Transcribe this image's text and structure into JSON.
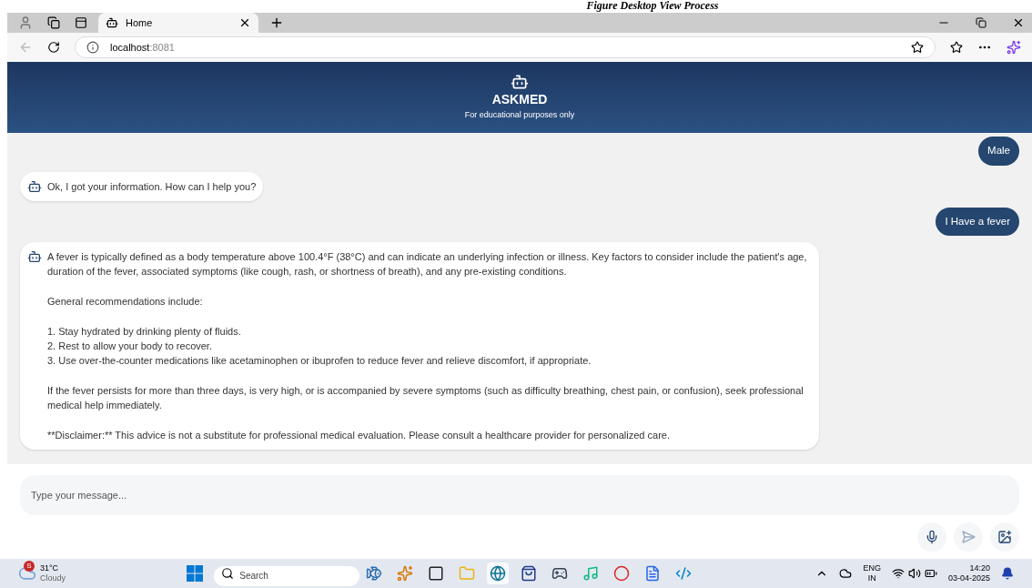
{
  "caption": "Figure Desktop View Process",
  "browser": {
    "tab_title": "Home",
    "url_host": "localhost",
    "url_port": ":8081"
  },
  "header": {
    "title": "ASKMED",
    "subtitle": "For educational purposes only"
  },
  "messages": [
    {
      "kind": "user",
      "blocks": [
        [
          "Male"
        ]
      ]
    },
    {
      "kind": "bot",
      "blocks": [
        [
          "Ok, I got your information. How can I help you?"
        ]
      ]
    },
    {
      "kind": "user",
      "blocks": [
        [
          "I Have a fever"
        ]
      ]
    },
    {
      "kind": "bot",
      "blocks": [
        [
          "A fever is typically defined as a body temperature above 100.4°F (38°C) and can indicate an underlying infection or illness. Key factors to consider include the patient's age, duration of the fever, associated symptoms (like cough, rash, or shortness of breath), and any pre-existing conditions."
        ],
        [
          "General recommendations include:"
        ],
        [
          "1. Stay hydrated by drinking plenty of fluids.",
          "2. Rest to allow your body to recover.",
          "3. Use over-the-counter medications like acetaminophen or ibuprofen to reduce fever and relieve discomfort, if appropriate."
        ],
        [
          "If the fever persists for more than three days, is very high, or is accompanied by severe symptoms (such as difficulty breathing, chest pain, or confusion), seek professional medical help immediately."
        ],
        [
          "**Disclaimer:** This advice is not a substitute for professional medical evaluation. Please consult a healthcare provider for personalized care."
        ]
      ]
    }
  ],
  "input": {
    "placeholder": "Type your message..."
  },
  "taskbar": {
    "weather_badge": "S",
    "temperature": "31°C",
    "condition": "Cloudy",
    "search_placeholder": "Search",
    "apps": [
      {
        "kind": "fish",
        "selected": false
      },
      {
        "kind": "copilot",
        "selected": false
      },
      {
        "kind": "window",
        "selected": false
      },
      {
        "kind": "folder",
        "selected": false
      },
      {
        "kind": "edge",
        "selected": true
      },
      {
        "kind": "store",
        "selected": false
      },
      {
        "kind": "game",
        "selected": false
      },
      {
        "kind": "music",
        "selected": false
      },
      {
        "kind": "chrome",
        "selected": false
      },
      {
        "kind": "word",
        "selected": false
      },
      {
        "kind": "code",
        "selected": false
      }
    ],
    "language": "ENG",
    "region": "IN",
    "time": "14:20",
    "date": "03-04-2025"
  }
}
